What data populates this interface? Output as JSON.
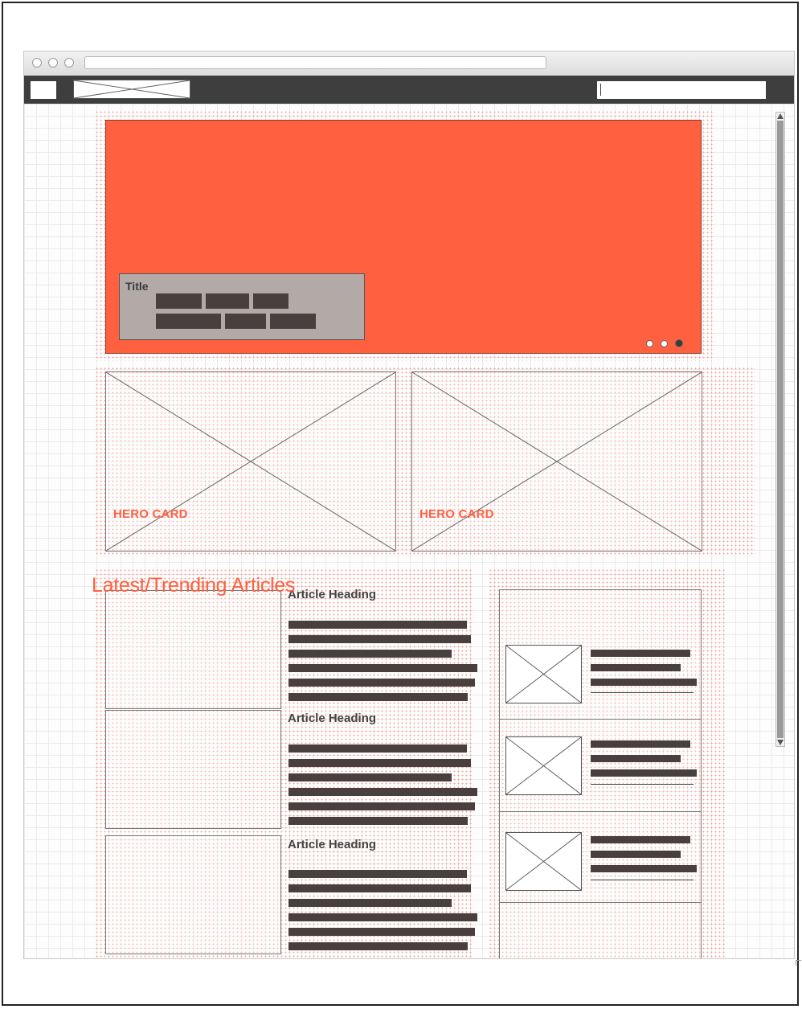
{
  "hero": {
    "title": "Title",
    "carousel_slides": 3,
    "carousel_active_index": 2
  },
  "cards": [
    {
      "label": "HERO CARD"
    },
    {
      "label": "HERO CARD"
    }
  ],
  "articles_section": {
    "title": "Latest/Trending Articles",
    "articles": [
      {
        "heading": "Article Heading"
      },
      {
        "heading": "Article Heading"
      },
      {
        "heading": "Article Heading"
      }
    ]
  },
  "colors": {
    "accent": "#ff6040",
    "nav_bar": "#3e3e3e",
    "text_block": "#4a3f3f"
  },
  "icons": [
    "image-placeholder-icon",
    "carousel-dot-icon"
  ]
}
